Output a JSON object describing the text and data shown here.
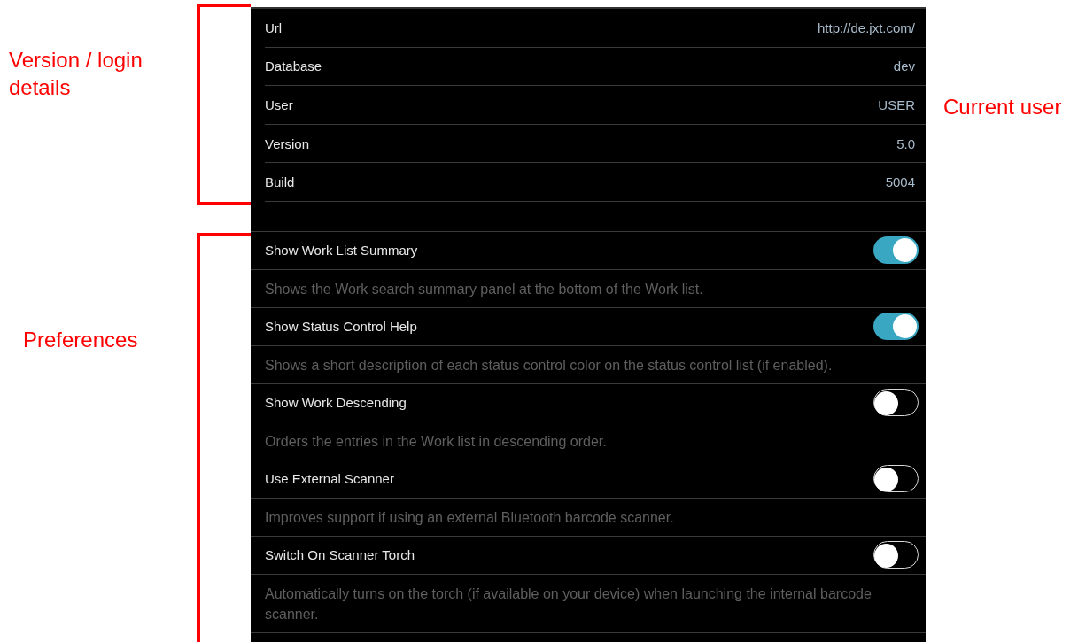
{
  "annotations": {
    "login": "Version / login details",
    "preferences": "Preferences",
    "user": "Current user"
  },
  "info_rows": [
    {
      "label": "Url",
      "value": "http://de.jxt.com/"
    },
    {
      "label": "Database",
      "value": "dev"
    },
    {
      "label": "User",
      "value": "USER"
    },
    {
      "label": "Version",
      "value": "5.0"
    },
    {
      "label": "Build",
      "value": "5004"
    }
  ],
  "preferences": [
    {
      "title": "Show Work List Summary",
      "on": true,
      "description": "Shows the Work search summary panel at the bottom of the Work list."
    },
    {
      "title": "Show Status Control Help",
      "on": true,
      "description": "Shows a short description of each status control color on the status control list (if enabled)."
    },
    {
      "title": "Show Work Descending",
      "on": false,
      "description": "Orders the entries in the Work list in descending order."
    },
    {
      "title": "Use External Scanner",
      "on": false,
      "description": "Improves support if using an external Bluetooth barcode scanner."
    },
    {
      "title": "Switch On Scanner Torch",
      "on": false,
      "description": "Automatically turns on the torch (if available on your device) when launching the internal barcode scanner."
    }
  ]
}
